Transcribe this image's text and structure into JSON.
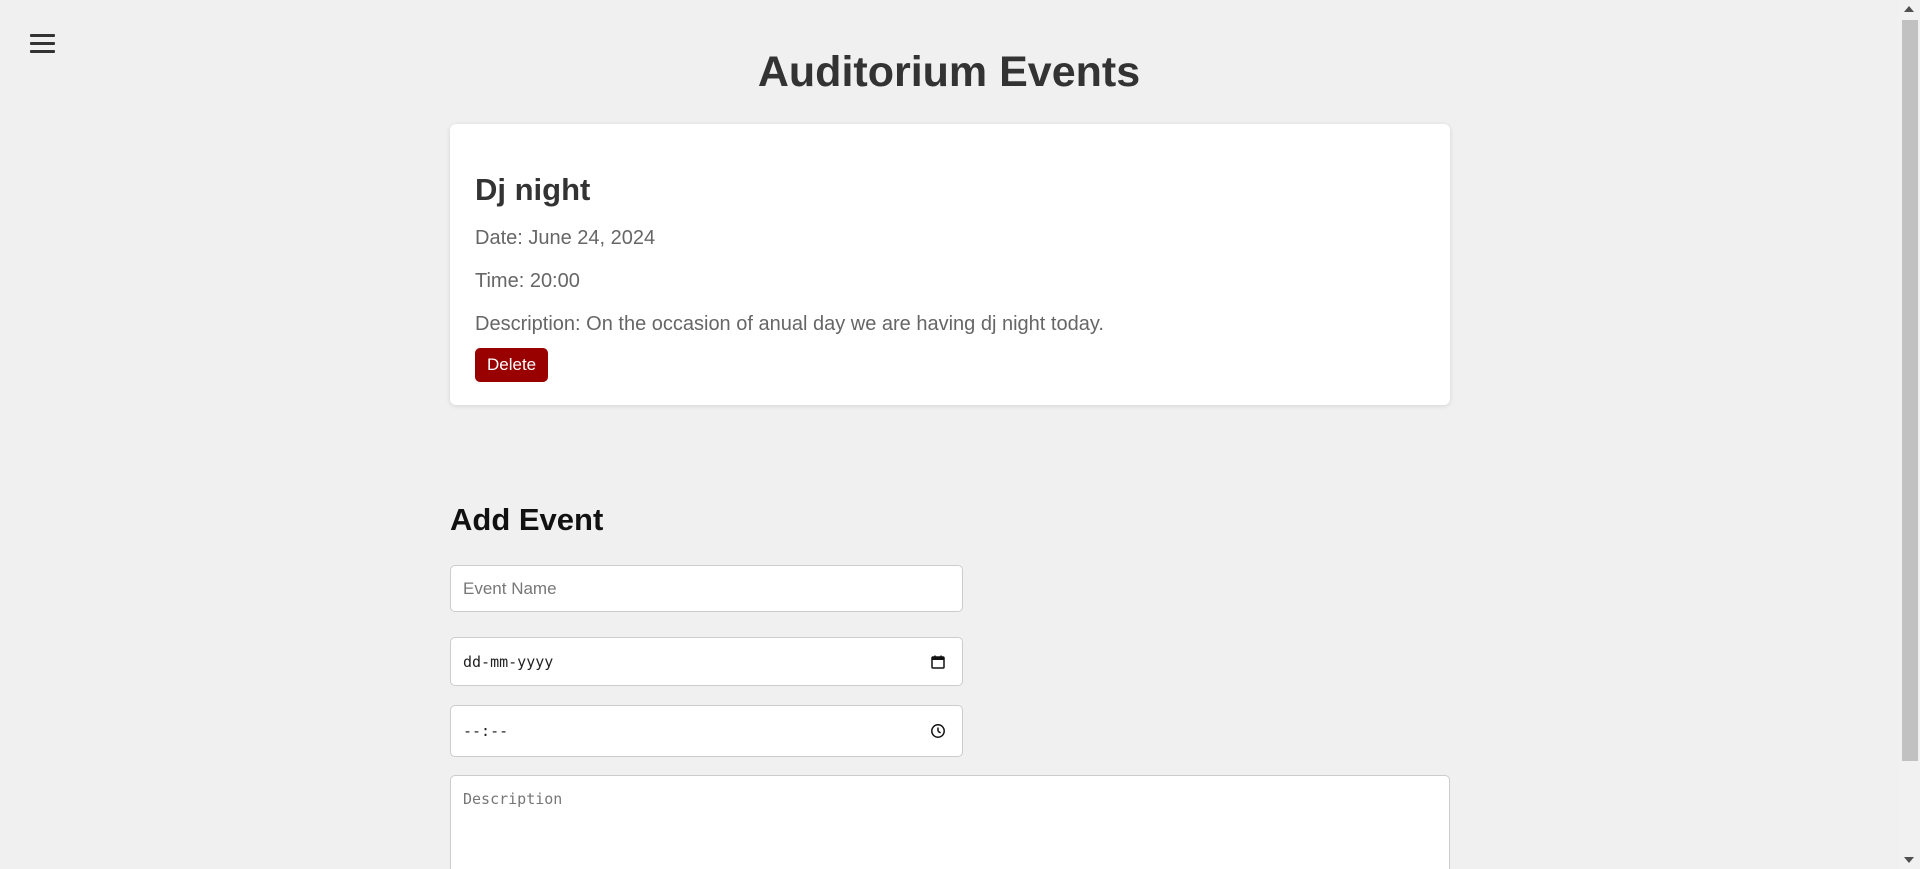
{
  "header": {
    "menu_icon": "hamburger-menu-icon",
    "title": "Auditorium Events"
  },
  "events": [
    {
      "name": "Dj night",
      "date_line": "Date: June 24, 2024",
      "time_line": "Time: 20:00",
      "description_line": "Description: On the occasion of anual day we are having dj night today.",
      "delete_label": "Delete",
      "delete_color": "#990000"
    }
  ],
  "add_event": {
    "title": "Add Event",
    "name_placeholder": "Event Name",
    "date_placeholder": "dd-mm-yyyy",
    "date_icon": "calendar-icon",
    "time_placeholder": "--:--",
    "time_icon": "clock-icon",
    "description_placeholder": "Description"
  },
  "colors": {
    "background": "#f0f0f0",
    "card": "#ffffff",
    "text": "#333333",
    "muted_text": "#666666"
  }
}
